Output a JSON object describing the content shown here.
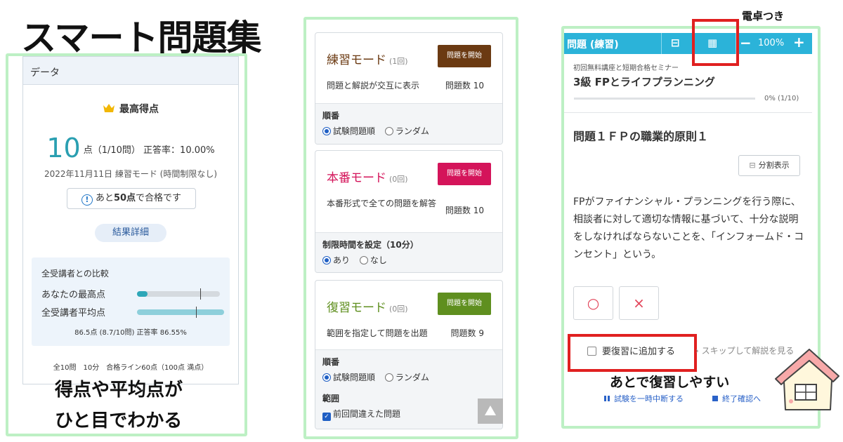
{
  "headline": "スマート問題集",
  "panel1": {
    "header": "データ",
    "best_title": "最高得点",
    "score_value": "10",
    "score_unit": "点",
    "score_detail": "（1/10問） 正答率：10.00%",
    "date_line": "2022年11月11日 練習モード (時間制限なし)",
    "pass_pre": "あと",
    "pass_bold": "50点",
    "pass_post": "で合格です",
    "result_button": "結果詳細",
    "compare_title": "全受講者との比較",
    "your_best_label": "あなたの最高点",
    "average_label": "全受講者平均点",
    "your_best_fraction": 0.13,
    "average_fraction": 0.87,
    "pass_line_fraction": 0.6,
    "compare_note": "86.5点 (8.7/10問) 正答率 86.55%",
    "footnote": "全10問　10分　合格ライン60点（100点 満点）",
    "caption_line1": "得点や平均点が",
    "caption_line2": "ひと目でわかる"
  },
  "panel2": {
    "practice": {
      "title": "練習モード",
      "count": "(1回)",
      "start": "問題を開始",
      "color": "#6b3a12",
      "desc": "問題と解説が交互に表示",
      "qcount": "問題数 10",
      "opt_label": "順番",
      "opt_a": "試験問題順",
      "opt_b": "ランダム"
    },
    "exam": {
      "title": "本番モード",
      "count": "(0回)",
      "start": "問題を開始",
      "color": "#d4145a",
      "desc": "本番形式で全ての問題を解答",
      "qcount": "問題数 10",
      "opt_label": "制限時間を設定（10分）",
      "opt_a": "あり",
      "opt_b": "なし"
    },
    "review": {
      "title": "復習モード",
      "count": "(0回)",
      "start": "問題を開始",
      "color": "#5f8f1f",
      "desc": "範囲を指定して問題を出題",
      "qcount": "問題数 9",
      "opt_label": "順番",
      "opt_a": "試験問題順",
      "opt_b": "ランダム",
      "range_label": "範囲",
      "range_item": "前回間違えた問題"
    },
    "title_colors": {
      "practice": "#6b3a12",
      "exam": "#d4145a",
      "review": "#5f8f1f"
    }
  },
  "panel3": {
    "bar_title": "問題 (練習)",
    "zoom": "100%",
    "calc_label": "電卓つき",
    "seminar": "初回無料講座と短期合格セミナー",
    "course": "3級 FPとライフプランニング",
    "progress_text": "0% (1/10)",
    "progress_fraction": 0.0,
    "question_title": "問題１ＦＰの職業的原則１",
    "split_button": "分割表示",
    "question_text": "FPがファイナンシャル・プランニングを行う際に、相談者に対して適切な情報に基づいて、十分な説明をしなければならないことを、「インフォームド・コンセント」という。",
    "answer_true": "○",
    "answer_false": "×",
    "review_checkbox": "要復習に追加する",
    "skip_link": "› スキップして解説を見る",
    "caption": "あとで復習しやすい",
    "pause_link": "試験を一時中断する",
    "finish_link": "終了確認へ"
  },
  "colors": {
    "frame": "#bdf0c4",
    "accent": "#2bb3d9",
    "highlight": "#e02020",
    "score": "#2a9fb1"
  }
}
